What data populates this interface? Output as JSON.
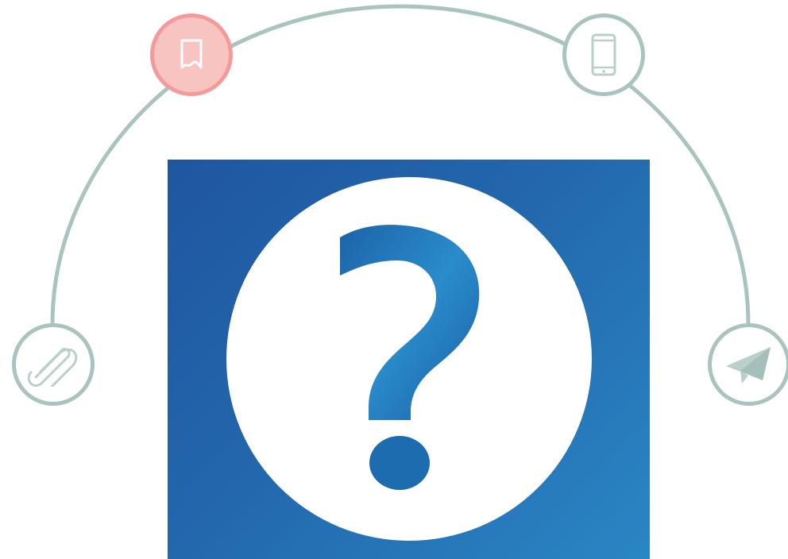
{
  "diagram": {
    "nodes": [
      {
        "id": "bookmark",
        "icon": "bookmark-icon",
        "state": "active"
      },
      {
        "id": "phone",
        "icon": "smartphone-icon",
        "state": "inactive"
      },
      {
        "id": "clip",
        "icon": "paperclip-icon",
        "state": "inactive"
      },
      {
        "id": "send",
        "icon": "paper-plane-icon",
        "state": "inactive"
      }
    ],
    "center": {
      "icon": "question-mark-icon"
    }
  },
  "colors": {
    "arc": "#a9c3be",
    "active_fill": "#f7c4c2",
    "active_border": "#f49a98",
    "icon_inactive": "#b9cfca",
    "panel_dark": "#1f56a0",
    "panel_light": "#2a86c4",
    "glyph": "#1d6aae"
  }
}
